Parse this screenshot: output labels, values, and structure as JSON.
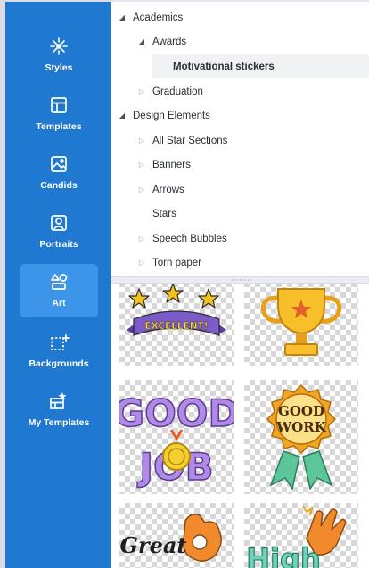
{
  "sidebar": {
    "items": [
      {
        "label": "Styles",
        "icon": "styles-icon"
      },
      {
        "label": "Templates",
        "icon": "templates-icon"
      },
      {
        "label": "Candids",
        "icon": "candids-icon"
      },
      {
        "label": "Portraits",
        "icon": "portraits-icon"
      },
      {
        "label": "Art",
        "icon": "art-icon",
        "active": true
      },
      {
        "label": "Backgrounds",
        "icon": "backgrounds-icon"
      },
      {
        "label": "My Templates",
        "icon": "my-templates-icon"
      }
    ],
    "colors": {
      "background": "#1f79d0",
      "active": "#3d95ea"
    }
  },
  "tree": {
    "rows": [
      {
        "label": "Academics",
        "state": "expanded"
      },
      {
        "label": "Awards",
        "state": "expanded"
      },
      {
        "label": "Motivational stickers",
        "state": "leaf",
        "selected": true
      },
      {
        "label": "Graduation",
        "state": "collapsed"
      },
      {
        "label": "Design Elements",
        "state": "expanded"
      },
      {
        "label": "All Star Sections",
        "state": "collapsed"
      },
      {
        "label": "Banners",
        "state": "collapsed"
      },
      {
        "label": "Arrows",
        "state": "collapsed"
      },
      {
        "label": "Stars",
        "state": "leaf"
      },
      {
        "label": "Speech Bubbles",
        "state": "collapsed"
      },
      {
        "label": "Torn paper",
        "state": "collapsed"
      }
    ]
  },
  "stickers": {
    "excellent": {
      "text": "EXCELLENT!"
    },
    "trophy": {
      "name": "trophy"
    },
    "good_job": {
      "line1": "GOOD",
      "line2": "JOB"
    },
    "good_work": {
      "line1": "GOOD",
      "line2": "WORK"
    },
    "great": {
      "text": "Great"
    },
    "high": {
      "text": "High"
    }
  }
}
